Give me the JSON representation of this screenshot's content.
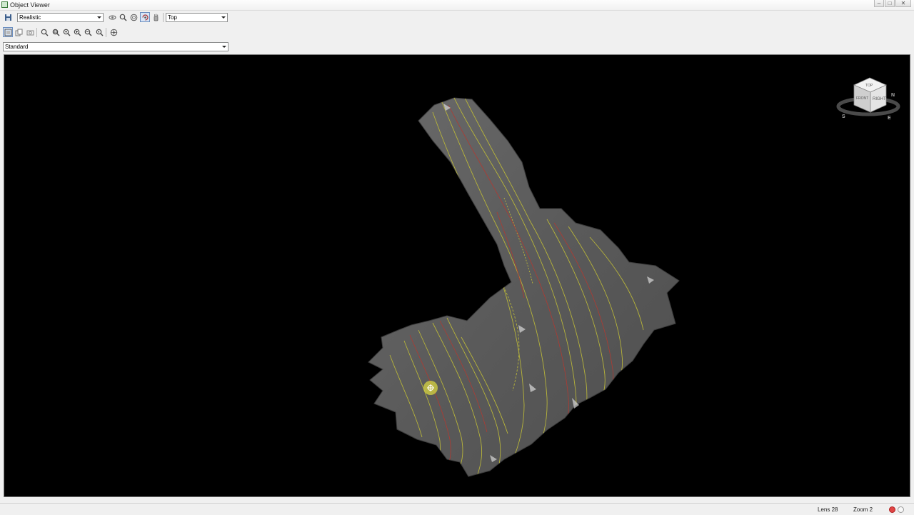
{
  "window": {
    "title": "Object Viewer",
    "controls": {
      "minimize": "–",
      "maximize": "□",
      "close": "✕"
    }
  },
  "toolbar": {
    "visual_style": {
      "selected": "Realistic"
    },
    "view": {
      "selected": "Top"
    },
    "display_mode": {
      "selected": "Standard"
    }
  },
  "viewcube": {
    "faces": {
      "top": "TOP",
      "front": "FRONT",
      "right": "RIGHT"
    },
    "compass": {
      "north": "N",
      "south": "S",
      "east": "E"
    }
  },
  "status": {
    "lens": "Lens 28",
    "zoom": "Zoom 2"
  },
  "colors": {
    "viewport_background": "#000000",
    "surface": "#5e5e5e",
    "contour_major": "#b7b43a",
    "contour_minor": "#b03a32",
    "cursor_highlight": "#d8d640"
  }
}
